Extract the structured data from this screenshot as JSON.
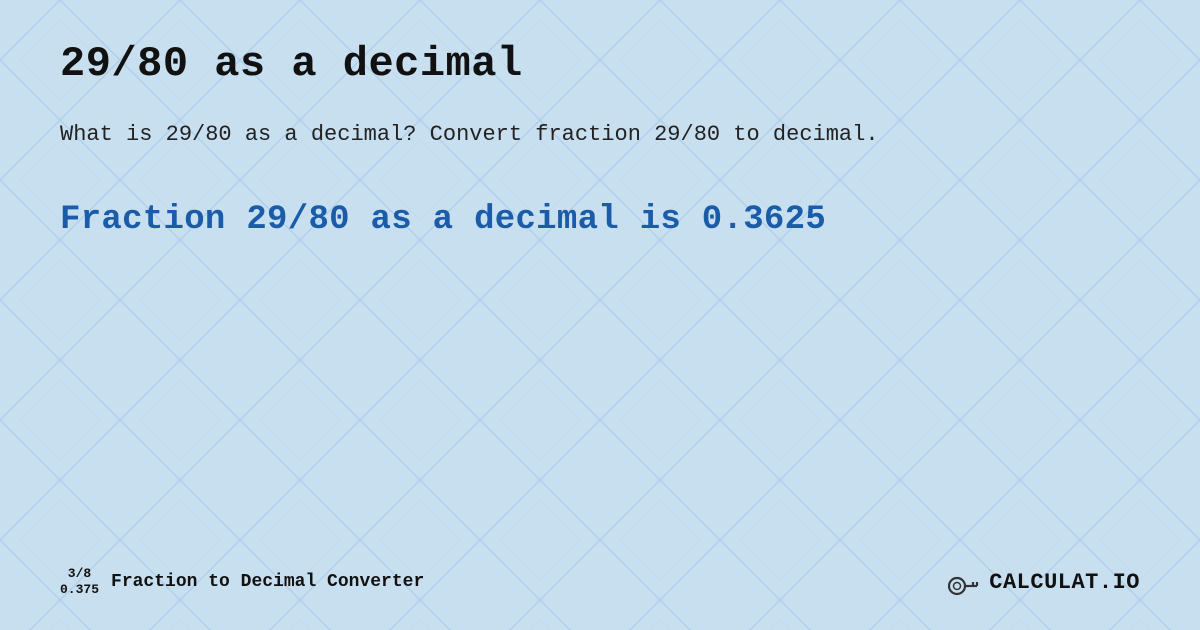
{
  "page": {
    "title": "29/80 as a decimal",
    "description": "What is 29/80 as a decimal? Convert fraction 29/80 to decimal.",
    "result": "Fraction 29/80 as a decimal is 0.3625",
    "bg_color": "#c8dff0"
  },
  "footer": {
    "fraction_numerator": "3/8",
    "fraction_denominator": "0.375",
    "label": "Fraction to Decimal Converter",
    "brand": "CALCULAT.IO"
  }
}
